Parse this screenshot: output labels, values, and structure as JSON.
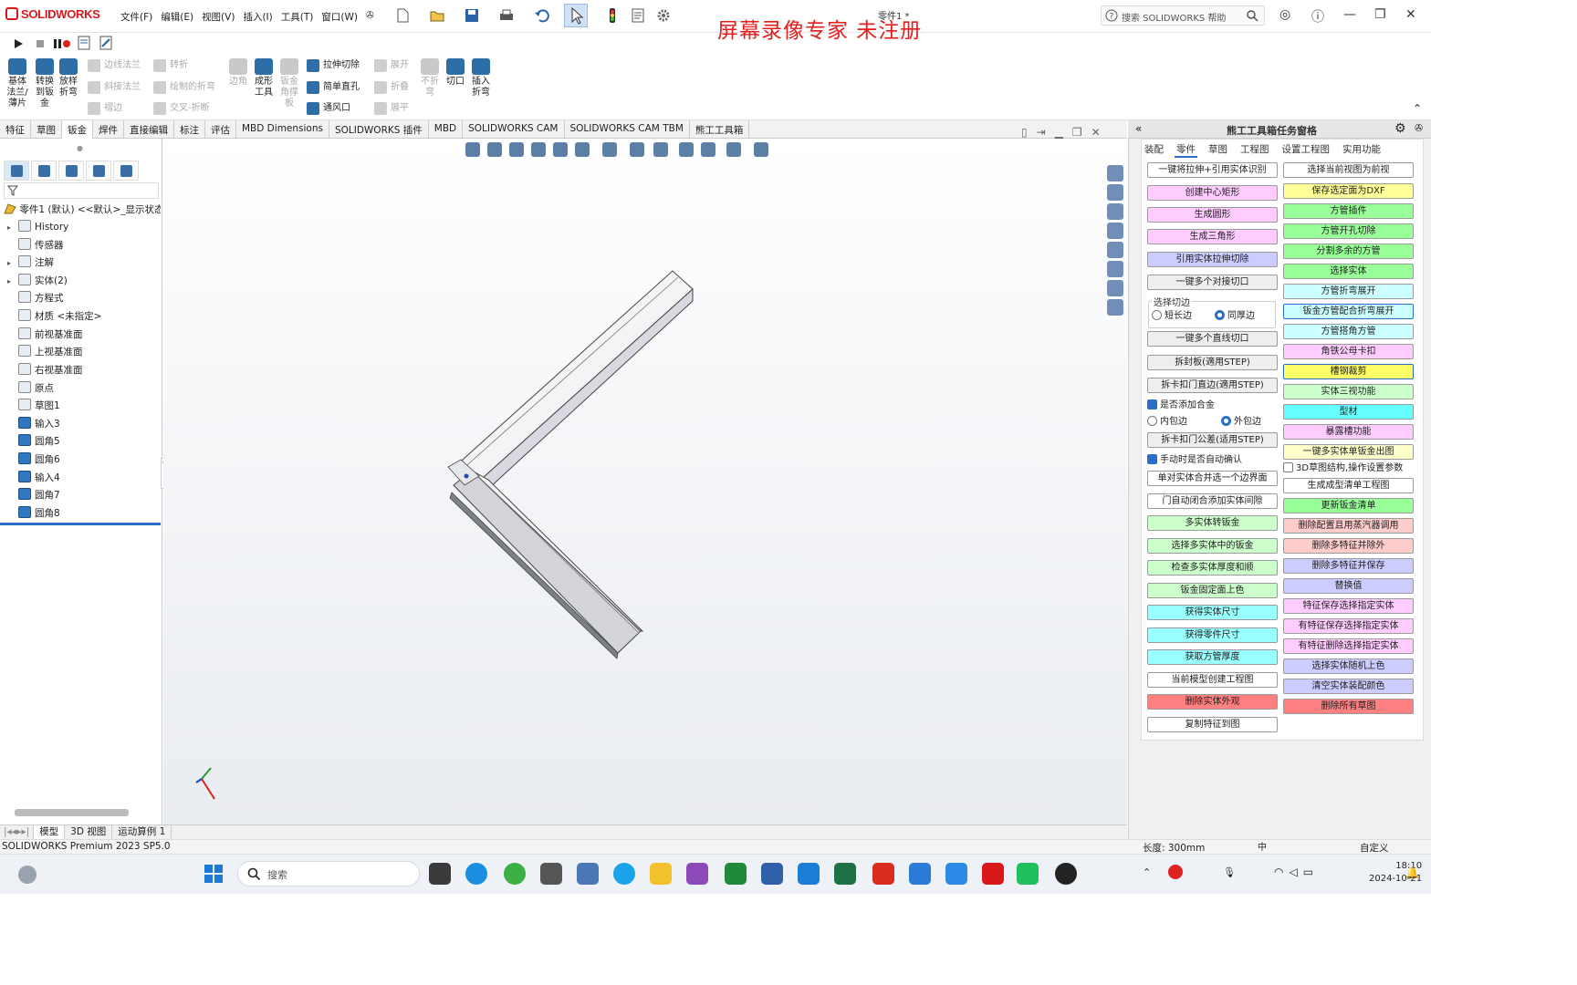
{
  "app": {
    "logo": "SOLIDWORKS",
    "menus": [
      "文件(F)",
      "编辑(E)",
      "视图(V)",
      "插入(I)",
      "工具(T)",
      "窗口(W)"
    ],
    "doc_title": "零件1 *",
    "watermark": "屏幕录像专家 未注册",
    "help_placeholder": "搜索 SOLIDWORKS 帮助"
  },
  "command_manager": {
    "big_buttons": [
      {
        "label": "基体法兰/薄片",
        "enabled": true
      },
      {
        "label": "转换到钣金",
        "enabled": true
      },
      {
        "label": "放样折弯",
        "enabled": true
      },
      {
        "label": "边角",
        "enabled": false
      },
      {
        "label": "成形工具",
        "enabled": true
      },
      {
        "label": "钣金角撑板",
        "enabled": false
      },
      {
        "label": "不折弯",
        "enabled": false
      },
      {
        "label": "切口",
        "enabled": true
      },
      {
        "label": "插入折弯",
        "enabled": true
      }
    ],
    "small_buttons": [
      {
        "label": "边线法兰",
        "enabled": false
      },
      {
        "label": "斜接法兰",
        "enabled": false
      },
      {
        "label": "褶边",
        "enabled": false
      },
      {
        "label": "转折",
        "enabled": false
      },
      {
        "label": "绘制的折弯",
        "enabled": false
      },
      {
        "label": "交叉-折断",
        "enabled": false
      },
      {
        "label": "拉伸切除",
        "enabled": true
      },
      {
        "label": "简单直孔",
        "enabled": true
      },
      {
        "label": "通风口",
        "enabled": true
      },
      {
        "label": "展开",
        "enabled": false
      },
      {
        "label": "折叠",
        "enabled": false
      },
      {
        "label": "展平",
        "enabled": false
      }
    ],
    "tabs": [
      "特征",
      "草图",
      "钣金",
      "焊件",
      "直接编辑",
      "标注",
      "评估",
      "MBD Dimensions",
      "SOLIDWORKS 插件",
      "MBD",
      "SOLIDWORKS CAM",
      "SOLIDWORKS CAM TBM",
      "熊工工具箱"
    ],
    "active_tab": "钣金"
  },
  "feature_tree": {
    "root": "零件1 (默认) <<默认>_显示状态 1>",
    "items": [
      {
        "label": "History",
        "expand": "▸",
        "solid": false
      },
      {
        "label": "传感器",
        "expand": "",
        "solid": false
      },
      {
        "label": "注解",
        "expand": "▸",
        "solid": false
      },
      {
        "label": "实体(2)",
        "expand": "▸",
        "solid": false
      },
      {
        "label": "方程式",
        "expand": "",
        "solid": false
      },
      {
        "label": "材质 <未指定>",
        "expand": "",
        "solid": false
      },
      {
        "label": "前视基准面",
        "expand": "",
        "solid": false
      },
      {
        "label": "上视基准面",
        "expand": "",
        "solid": false
      },
      {
        "label": "右视基准面",
        "expand": "",
        "solid": false
      },
      {
        "label": "原点",
        "expand": "",
        "solid": false
      },
      {
        "label": "草图1",
        "expand": "",
        "solid": false
      },
      {
        "label": "输入3",
        "expand": "",
        "solid": true
      },
      {
        "label": "圆角5",
        "expand": "",
        "solid": true
      },
      {
        "label": "圆角6",
        "expand": "",
        "solid": true
      },
      {
        "label": "输入4",
        "expand": "",
        "solid": true
      },
      {
        "label": "圆角7",
        "expand": "",
        "solid": true
      },
      {
        "label": "圆角8",
        "expand": "",
        "solid": true
      }
    ]
  },
  "bottom_tabs": [
    "模型",
    "3D 视图",
    "运动算例 1"
  ],
  "status": {
    "product": "SOLIDWORKS Premium 2023 SP5.0",
    "length": "长度: 300mm",
    "custom": "自定义"
  },
  "task_pane": {
    "title": "熊工工具箱任务窗格",
    "tabs": [
      "装配",
      "零件",
      "草图",
      "工程图",
      "设置工程图",
      "实用功能"
    ],
    "active_tab": "零件",
    "left_buttons": [
      {
        "label": "一键将拉伸+引用实体识别",
        "color": "#ffffff"
      },
      {
        "label": "创建中心矩形",
        "color": "#ffccff"
      },
      {
        "label": "生成圆形",
        "color": "#ffccff"
      },
      {
        "label": "生成三角形",
        "color": "#ffccff"
      },
      {
        "label": "引用实体拉伸切除",
        "color": "#ccccff"
      },
      {
        "label": "一键多个对接切口",
        "color": "#eeeeee"
      },
      {
        "label": "一键多个直线切口",
        "color": "#eeeeee"
      },
      {
        "label": "拆封板(適用STEP)",
        "color": "#eeeeee"
      },
      {
        "label": "拆卡扣门直边(適用STEP)",
        "color": "#eeeeee"
      },
      {
        "label": "拆卡扣门公差(适用STEP)",
        "color": "#eeeeee"
      },
      {
        "label": "单对实体合并选一个边界面",
        "color": "#ffffff"
      },
      {
        "label": "门自动闭合添加实体间隙",
        "color": "#ffffff"
      },
      {
        "label": "多实体转钣金",
        "color": "#ccffcc"
      },
      {
        "label": "选择多实体中的钣金",
        "color": "#ccffcc"
      },
      {
        "label": "检查多实体厚度和顺",
        "color": "#ccffcc"
      },
      {
        "label": "钣金固定面上色",
        "color": "#ccffcc"
      },
      {
        "label": "获得实体尺寸",
        "color": "#99ffff"
      },
      {
        "label": "获得零件尺寸",
        "color": "#99ffff"
      },
      {
        "label": "获取方管厚度",
        "color": "#99ffff"
      },
      {
        "label": "当前模型创建工程图",
        "color": "#ffffff"
      },
      {
        "label": "删除实体外观",
        "color": "#ff8080"
      },
      {
        "label": "复制特征到图",
        "color": "#ffffff"
      }
    ],
    "right_buttons": [
      {
        "label": "选择当前视图为前视",
        "color": "#ffffff"
      },
      {
        "label": "保存选定面为DXF",
        "color": "#ffff99"
      },
      {
        "label": "方管插件",
        "color": "#99ff99"
      },
      {
        "label": "方管开孔切除",
        "color": "#99ff99"
      },
      {
        "label": "分割多余的方管",
        "color": "#99ff99"
      },
      {
        "label": "选择实体",
        "color": "#99ff99"
      },
      {
        "label": "方管折弯展开",
        "color": "#ccffff"
      },
      {
        "label": "钣金方管配合折弯展开",
        "color": "#ccffff"
      },
      {
        "label": "方管搭角方管",
        "color": "#ccffff"
      },
      {
        "label": "角铁公母卡扣",
        "color": "#ffccff"
      },
      {
        "label": "槽钢裁剪",
        "color": "#ffff66"
      },
      {
        "label": "实体三视功能",
        "color": "#ccffcc"
      },
      {
        "label": "型材",
        "color": "#66ffff"
      },
      {
        "label": "暴露槽功能",
        "color": "#ffccff"
      },
      {
        "label": "一键多实体单钣金出图",
        "color": "#ffffcc"
      },
      {
        "label": "生成成型清单工程图",
        "color": "#ffffff"
      },
      {
        "label": "更新钣金清单",
        "color": "#99ff99"
      },
      {
        "label": "删除配置且用蒸汽器调用",
        "color": "#ffcccc"
      },
      {
        "label": "删除多特征并除外",
        "color": "#ffcccc"
      },
      {
        "label": "删除多特征并保存",
        "color": "#ccccff"
      },
      {
        "label": "替换值",
        "color": "#ccccff"
      },
      {
        "label": "特征保存选择指定实体",
        "color": "#ffccff"
      },
      {
        "label": "有特征保存选择指定实体",
        "color": "#ffccff"
      },
      {
        "label": "有特征删除选择指定实体",
        "color": "#ffccff"
      },
      {
        "label": "选择实体随机上色",
        "color": "#ccccff"
      },
      {
        "label": "清空实体装配颜色",
        "color": "#ccccff"
      },
      {
        "label": "删除所有草图",
        "color": "#ff8080"
      }
    ],
    "direction_group": "选择切边",
    "radio_long": "短长边",
    "radio_short": "同厚边",
    "chk_merge": "是否添加合金",
    "radio_inside": "内包边",
    "radio_outside": "外包边",
    "chk_confirm": "手动时是否自动确认",
    "chk_3d": "3D草图结构,操作设置参数"
  },
  "taskbar": {
    "search_placeholder": "搜索",
    "time": "18:10",
    "date": "2024-10-21",
    "ime": "中"
  }
}
